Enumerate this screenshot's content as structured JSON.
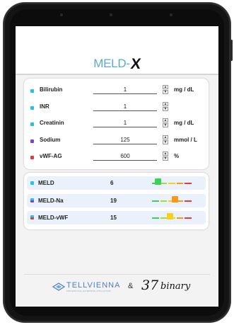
{
  "app": {
    "logo_text": "MELD-",
    "logo_mark": "X"
  },
  "inputs": [
    {
      "label": "Bilirubin",
      "value": "1",
      "unit": "mg / dL",
      "color": "#22c3e6"
    },
    {
      "label": "INR",
      "value": "1",
      "unit": "",
      "color": "#22c3e6"
    },
    {
      "label": "Creatinin",
      "value": "1",
      "unit": "mg / dL",
      "color": "#22c3e6"
    },
    {
      "label": "Sodium",
      "value": "125",
      "unit": "mmol / L",
      "color": "#7b3fe4"
    },
    {
      "label": "vWF-AG",
      "value": "600",
      "unit": "%",
      "color": "#e03c3c"
    }
  ],
  "stepper": {
    "up": "▲",
    "down": "▼"
  },
  "results": [
    {
      "label": "MELD",
      "value": "6",
      "level": 0.1,
      "marker_color": "#3ccf5a",
      "dot_colors": [
        "#22c3e6"
      ]
    },
    {
      "label": "MELD-Na",
      "value": "19",
      "level": 0.6,
      "marker_color": "#f59a1a",
      "dot_colors": [
        "#22c3e6",
        "#7b3fe4"
      ]
    },
    {
      "label": "MELD-vWF",
      "value": "15",
      "level": 0.45,
      "marker_color": "#f4d21c",
      "dot_colors": [
        "#22c3e6",
        "#e03c3c"
      ]
    }
  ],
  "scale_colors": [
    "#3ccf5a",
    "#a6d93a",
    "#f4d21c",
    "#f59a1a",
    "#e03c3c"
  ],
  "footer": {
    "partner1": "TELLVIENNA",
    "partner1_tagline": "PROFESSIONAL ENTERPRISE APPLICATIONS",
    "ampersand": "&",
    "partner2_number": "37",
    "partner2_word": "binary"
  }
}
